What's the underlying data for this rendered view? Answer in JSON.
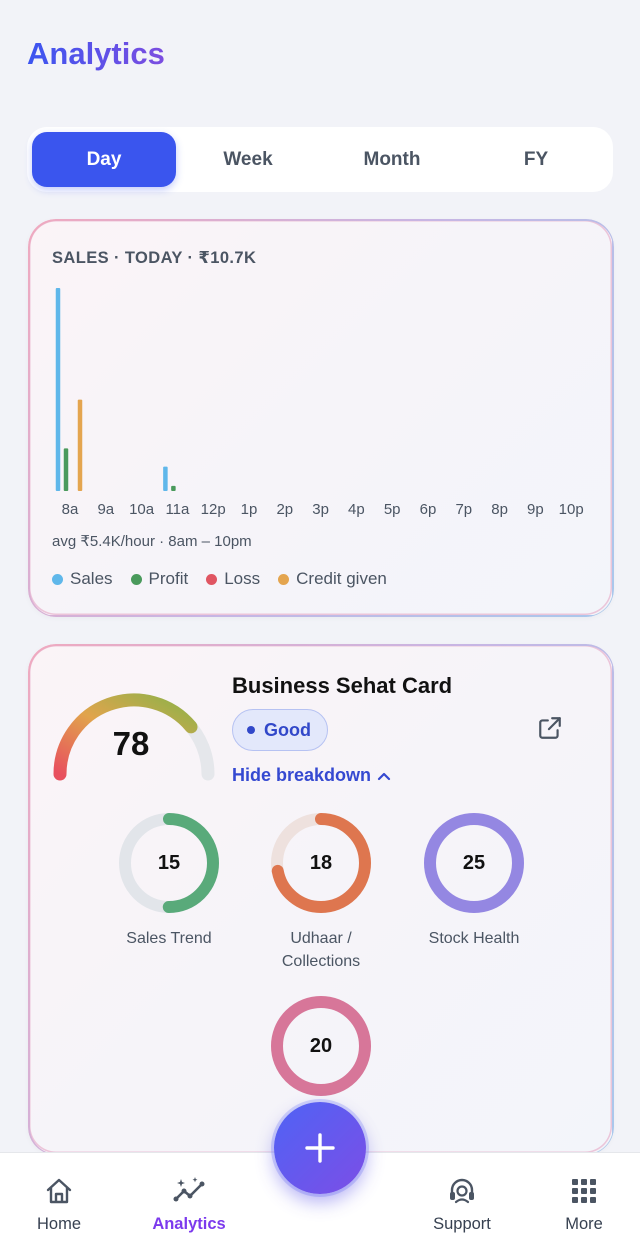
{
  "header": {
    "title": "Analytics"
  },
  "period_tabs": [
    {
      "label": "Day",
      "active": true
    },
    {
      "label": "Week",
      "active": false
    },
    {
      "label": "Month",
      "active": false
    },
    {
      "label": "FY",
      "active": false
    }
  ],
  "sales_card": {
    "title": "SALES · TODAY · ₹10.7K",
    "avg_text": "avg ₹5.4K/hour · 8am – 10pm",
    "legend": [
      {
        "label": "Sales",
        "color": "#5fb7ea"
      },
      {
        "label": "Profit",
        "color": "#4a9a5c"
      },
      {
        "label": "Loss",
        "color": "#e05562"
      },
      {
        "label": "Credit given",
        "color": "#e4a54f"
      }
    ]
  },
  "chart_data": {
    "type": "bar",
    "categories": [
      "8a",
      "9a",
      "10a",
      "11a",
      "12p",
      "1p",
      "2p",
      "3p",
      "4p",
      "5p",
      "6p",
      "7p",
      "8p",
      "9p",
      "10p"
    ],
    "series": [
      {
        "name": "Sales",
        "color": "#5fb7ea",
        "values": [
          100,
          0,
          0,
          12,
          0,
          0,
          0,
          0,
          0,
          0,
          0,
          0,
          0,
          0,
          0
        ]
      },
      {
        "name": "Profit",
        "color": "#4a9a5c",
        "values": [
          21,
          0,
          0,
          2.5,
          0,
          0,
          0,
          0,
          0,
          0,
          0,
          0,
          0,
          0,
          0
        ]
      },
      {
        "name": "Loss",
        "color": "#e05562",
        "values": [
          0,
          0,
          0,
          0,
          0,
          0,
          0,
          0,
          0,
          0,
          0,
          0,
          0,
          0,
          0
        ]
      },
      {
        "name": "Credit given",
        "color": "#e4a54f",
        "values": [
          45,
          0,
          0,
          0,
          0,
          0,
          0,
          0,
          0,
          0,
          0,
          0,
          0,
          0,
          0
        ]
      }
    ],
    "title": "SALES · TODAY · ₹10.7K",
    "xlabel": "",
    "ylabel": "",
    "ylim": [
      0,
      100
    ],
    "grid": false,
    "legend_position": "bottom"
  },
  "sehat_card": {
    "title": "Business Sehat Card",
    "score": "78",
    "score_value": 78,
    "status": "Good",
    "toggle_label": "Hide breakdown",
    "breakdown": [
      {
        "value": "15",
        "fraction": 0.5,
        "label_lines": [
          "Sales Trend"
        ],
        "color": "#4aa36e",
        "track": "#e2e5ea"
      },
      {
        "value": "18",
        "fraction": 0.72,
        "label_lines": [
          "Udhaar /",
          "Collections"
        ],
        "color": "#dc6a3f",
        "track": "#eee1de"
      },
      {
        "value": "25",
        "fraction": 1.0,
        "label_lines": [
          "Stock Health"
        ],
        "color": "#8b7ce0",
        "track": "#e6e3f6"
      },
      {
        "value": "20",
        "fraction": 1.0,
        "label_lines": [],
        "color": "#d46a90",
        "track": "#f1dfe6"
      }
    ]
  },
  "bottom_nav": [
    {
      "label": "Home",
      "icon": "home-icon",
      "active": false
    },
    {
      "label": "Analytics",
      "icon": "analytics-icon",
      "active": true
    },
    {
      "label": "Support",
      "icon": "support-icon",
      "active": false
    },
    {
      "label": "More",
      "icon": "grid-icon",
      "active": false
    }
  ],
  "fab": {
    "icon": "plus-icon"
  }
}
